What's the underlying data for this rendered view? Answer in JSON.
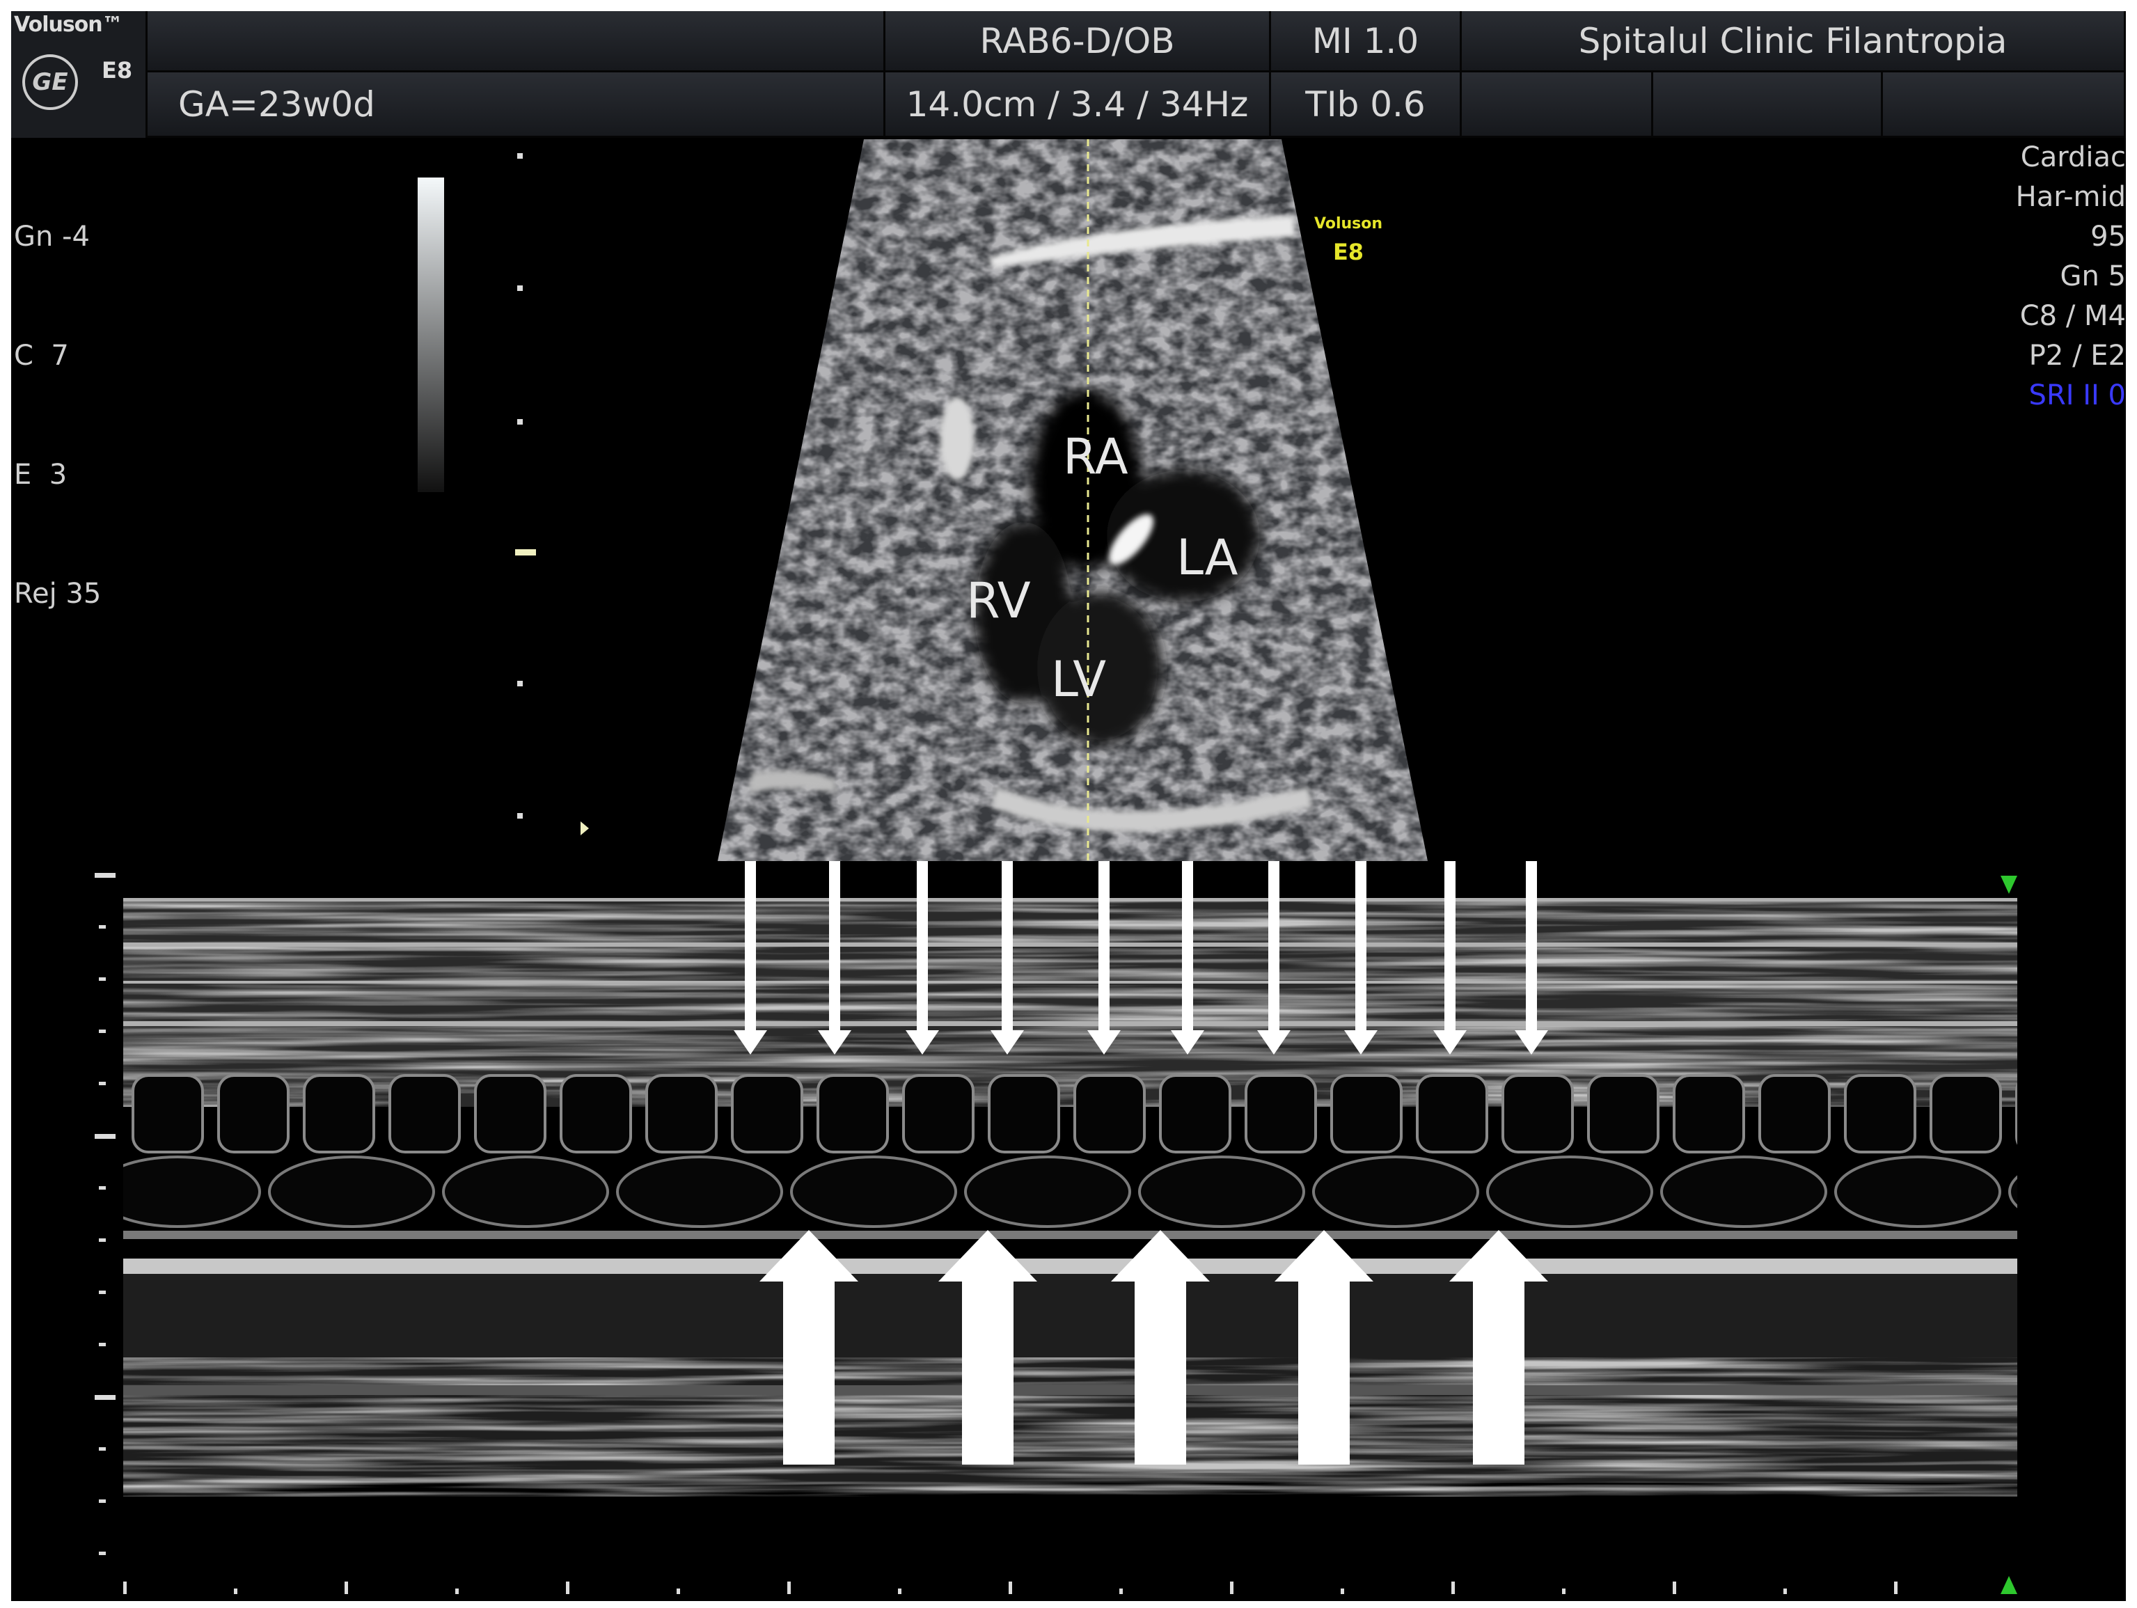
{
  "header": {
    "brand": "Voluson™",
    "model": "E8",
    "logo_text": "GE",
    "probe": "RAB6-D/OB",
    "mi": "MI 1.0",
    "institution": "Spitalul Clinic Filantropia",
    "gestational_age": "GA=23w0d",
    "depth_freq": "14.0cm / 3.4 / 34Hz",
    "tib": "TIb 0.6"
  },
  "left_params": [
    "Gn -4",
    "C  7",
    "E  3",
    "Rej 35"
  ],
  "right_params": [
    "Cardiac",
    "Har-mid",
    "95",
    "Gn  5",
    "C8 / M4",
    "P2 / E2"
  ],
  "sri": "SRI II 0",
  "watermark": {
    "brand": "Voluson",
    "model": "E8"
  },
  "chambers": {
    "ra": "RA",
    "la": "LA",
    "rv": "RV",
    "lv": "LV"
  },
  "annotations": {
    "thin_down_arrows": 10,
    "thick_up_arrows": 5
  },
  "colors": {
    "sri": "#3a3aff",
    "watermark": "#e6e62a",
    "marker": "#2ec82e",
    "mline": "#e8e890"
  }
}
